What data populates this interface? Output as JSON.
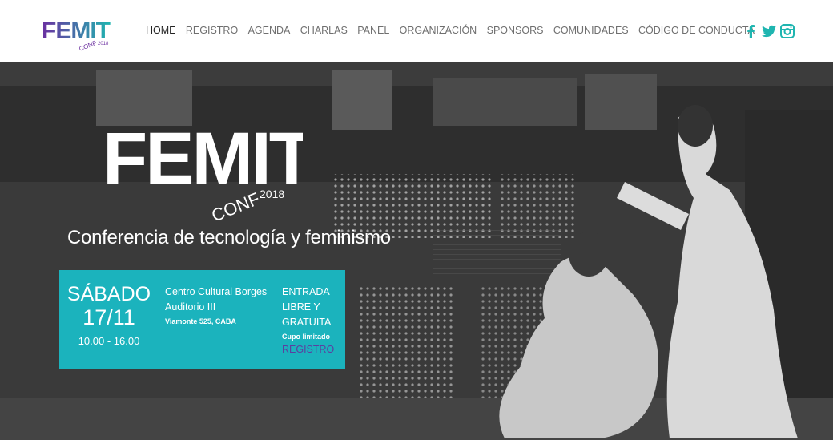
{
  "header": {
    "logo": {
      "text": "FEMIT",
      "sub": "CONF",
      "year": "2018"
    },
    "nav": [
      {
        "label": "HOME",
        "active": true
      },
      {
        "label": "REGISTRO"
      },
      {
        "label": "AGENDA"
      },
      {
        "label": "CHARLAS"
      },
      {
        "label": "PANEL"
      },
      {
        "label": "ORGANIZACIÓN"
      },
      {
        "label": "SPONSORS"
      },
      {
        "label": "COMUNIDADES"
      },
      {
        "label": "CÓDIGO DE CONDUCTA"
      }
    ],
    "social": [
      "facebook-icon",
      "twitter-icon",
      "instagram-icon"
    ]
  },
  "hero": {
    "logo": {
      "text": "FEMIT",
      "sub": "CONF",
      "year": "2018"
    },
    "tagline": "Conferencia de tecnología y feminismo",
    "info": {
      "day": "SÁBADO",
      "date": "17/11",
      "hours": "10.00 - 16.00",
      "venue_line1": "Centro Cultural Borges",
      "venue_line2": "Auditorio III",
      "address": "Viamonte 525, CABA",
      "entry_line1": "ENTRADA",
      "entry_line2": "LIBRE Y",
      "entry_line3": "GRATUITA",
      "limited": "Cupo limitado",
      "register": "REGISTRO"
    }
  },
  "colors": {
    "accent": "#1bb3bd",
    "purple": "#6b2fa0",
    "teal": "#1fb5b0"
  }
}
